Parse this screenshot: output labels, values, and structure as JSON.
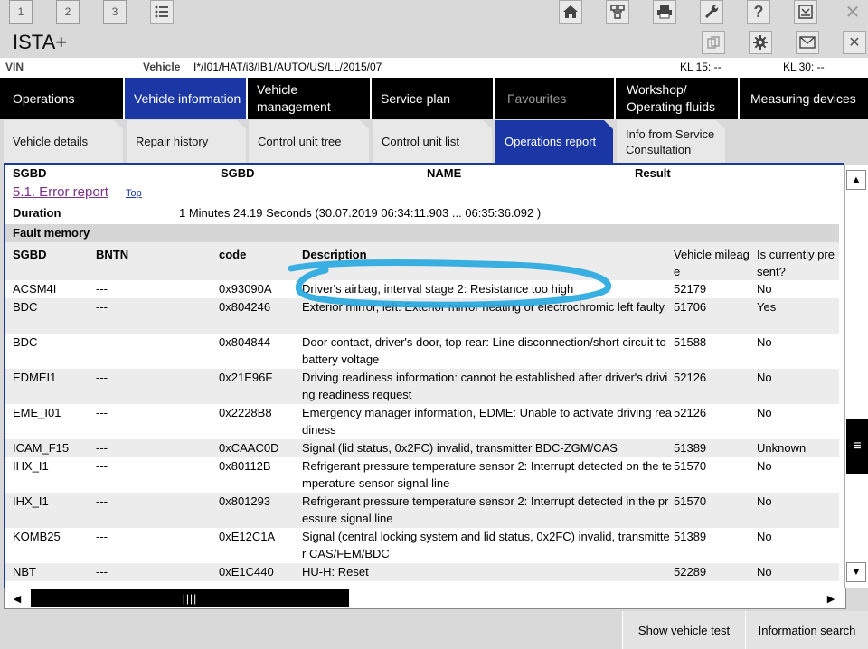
{
  "toolbar": {
    "tabs": [
      "1",
      "2",
      "3"
    ],
    "icons": [
      "list-icon",
      "home-icon",
      "network-icon",
      "printer-icon",
      "wrench-icon",
      "help-icon",
      "download-icon",
      "close-icon"
    ]
  },
  "header": {
    "title": "ISTA+",
    "icons": [
      "copy-icon",
      "gear-icon",
      "mail-icon",
      "close-icon"
    ]
  },
  "info": {
    "vin_label": "VIN",
    "vehicle_label": "Vehicle",
    "vehicle_value": "I*/I01/HAT/i3/IB1/AUTO/US/LL/2015/07",
    "kl15": "KL 15:  --",
    "kl30": "KL 30:  --"
  },
  "nav": [
    {
      "label": "Operations"
    },
    {
      "label": "Vehicle information"
    },
    {
      "label": "Vehicle management"
    },
    {
      "label": "Service plan"
    },
    {
      "label": "Favourites"
    },
    {
      "label": "Workshop/ Operating fluids"
    },
    {
      "label": "Measuring devices"
    }
  ],
  "subtabs": [
    {
      "label": "Vehicle details"
    },
    {
      "label": "Repair history"
    },
    {
      "label": "Control unit tree"
    },
    {
      "label": "Control unit list"
    },
    {
      "label": "Operations report"
    },
    {
      "label": "Info from Service Consultation"
    }
  ],
  "report": {
    "columns": [
      "SGBD",
      "SGBD",
      "NAME",
      "Result"
    ],
    "section_title": "5.1. Error report",
    "top_link": "Top",
    "duration_label": "Duration",
    "duration_value": "1 Minutes 24.19 Seconds (30.07.2019 06:34:11.903 ... 06:35:36.092 )",
    "fault_memory_label": "Fault memory",
    "table_headers": {
      "sgbd": "SGBD",
      "bntn": "BNTN",
      "code": "code",
      "description": "Description",
      "mileage": "Vehicle mileage",
      "present": "Is currently present?"
    },
    "rows": [
      {
        "sgbd": "ACSM4I",
        "bntn": "---",
        "code": "0x93090A",
        "description": "Driver's airbag, interval stage 2: Resistance too high",
        "mileage": "52179",
        "present": "No"
      },
      {
        "sgbd": "BDC",
        "bntn": "---",
        "code": "0x804246",
        "description": "Exterior mirror, left: Exterior mirror heating or electrochromic left faulty",
        "mileage": "51706",
        "present": "Yes"
      },
      {
        "sgbd": "BDC",
        "bntn": "---",
        "code": "0x804844",
        "description": "Door contact, driver's door, top rear: Line disconnection/short circuit to battery voltage",
        "mileage": "51588",
        "present": "No"
      },
      {
        "sgbd": "EDMEI1",
        "bntn": "---",
        "code": "0x21E96F",
        "description": "Driving readiness information: cannot be established after driver's driving readiness request",
        "mileage": "52126",
        "present": "No"
      },
      {
        "sgbd": "EME_I01",
        "bntn": "---",
        "code": "0x2228B8",
        "description": "Emergency manager information, EDME: Unable to activate driving readiness",
        "mileage": "52126",
        "present": "No"
      },
      {
        "sgbd": "ICAM_F15",
        "bntn": "---",
        "code": "0xCAAC0D",
        "description": "Signal (lid status, 0x2FC) invalid, transmitter BDC-ZGM/CAS",
        "mileage": "51389",
        "present": "Unknown"
      },
      {
        "sgbd": "IHX_I1",
        "bntn": "---",
        "code": "0x80112B",
        "description": "Refrigerant pressure temperature sensor 2: Interrupt detected on the temperature sensor signal line",
        "mileage": "51570",
        "present": "No"
      },
      {
        "sgbd": "IHX_I1",
        "bntn": "---",
        "code": "0x801293",
        "description": "Refrigerant pressure temperature sensor 2: Interrupt detected in the pressure signal line",
        "mileage": "51570",
        "present": "No"
      },
      {
        "sgbd": "KOMB25",
        "bntn": "---",
        "code": "0xE12C1A",
        "description": "Signal (central locking system and lid status, 0x2FC) invalid, transmitter CAS/FEM/BDC",
        "mileage": "51389",
        "present": "No"
      },
      {
        "sgbd": "NBT",
        "bntn": "---",
        "code": "0xE1C440",
        "description": "HU-H: Reset",
        "mileage": "52289",
        "present": "No"
      }
    ]
  },
  "bottom": {
    "show_vehicle_test": "Show vehicle test",
    "information_search": "Information search"
  },
  "colors": {
    "accent": "#1b36a5",
    "annotation": "#29a9e0",
    "section_link": "#7a3389"
  }
}
